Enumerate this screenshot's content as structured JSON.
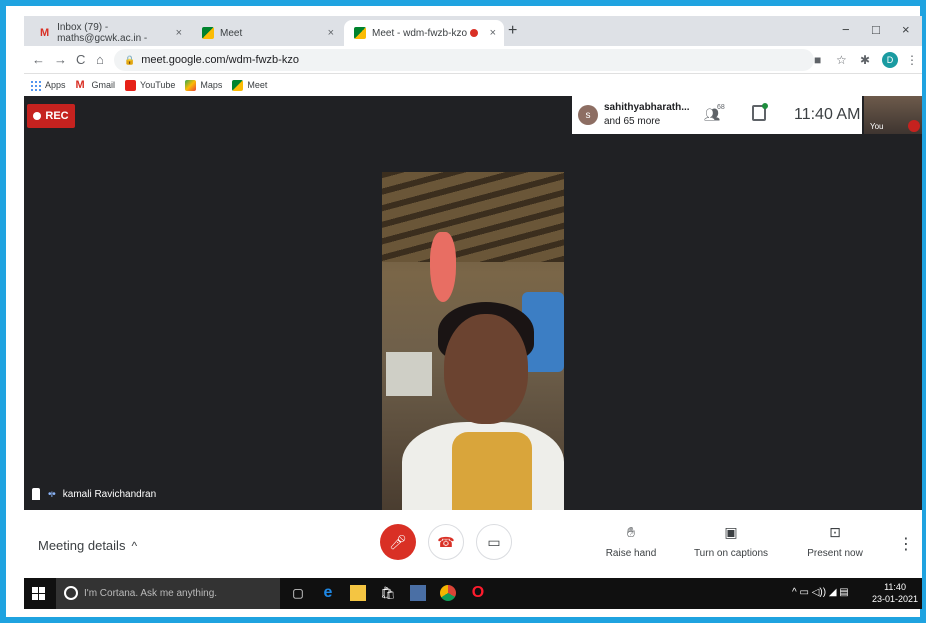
{
  "browser": {
    "tabs": [
      {
        "title": "Inbox (79) - maths@gcwk.ac.in -",
        "close": "×"
      },
      {
        "title": "Meet",
        "close": "×"
      },
      {
        "title": "Meet - wdm-fwzb-kzo",
        "close": "×"
      }
    ],
    "new_tab": "+",
    "window_controls": {
      "minimize": "−",
      "maximize": "□",
      "close": "×"
    },
    "nav": {
      "back": "←",
      "forward": "→",
      "reload": "C",
      "home": "⌂"
    },
    "url": "meet.google.com/wdm-fwzb-kzo",
    "profile_initial": "D",
    "bookmarks": [
      "Apps",
      "Gmail",
      "YouTube",
      "Maps",
      "Meet"
    ]
  },
  "meet": {
    "rec_label": "REC",
    "host_initial": "s",
    "host_name": "sahithyabharath...",
    "host_more": "and 65 more",
    "participant_count": "68",
    "time": "11:40 AM",
    "self_label": "You",
    "speaker_name": "kamali Ravichandran"
  },
  "controls": {
    "meeting_details": "Meeting details",
    "chevron": "^",
    "raise_hand": "Raise hand",
    "captions": "Turn on captions",
    "present": "Present now",
    "more": "⋮"
  },
  "taskbar": {
    "cortana_placeholder": "I'm Cortana. Ask me anything.",
    "time": "11:40",
    "date": "23-01-2021"
  },
  "colors": {
    "frame": "#1fa3e0",
    "meet_bg": "#202124",
    "rec_red": "#c5221f",
    "mic_off_red": "#d93025"
  }
}
